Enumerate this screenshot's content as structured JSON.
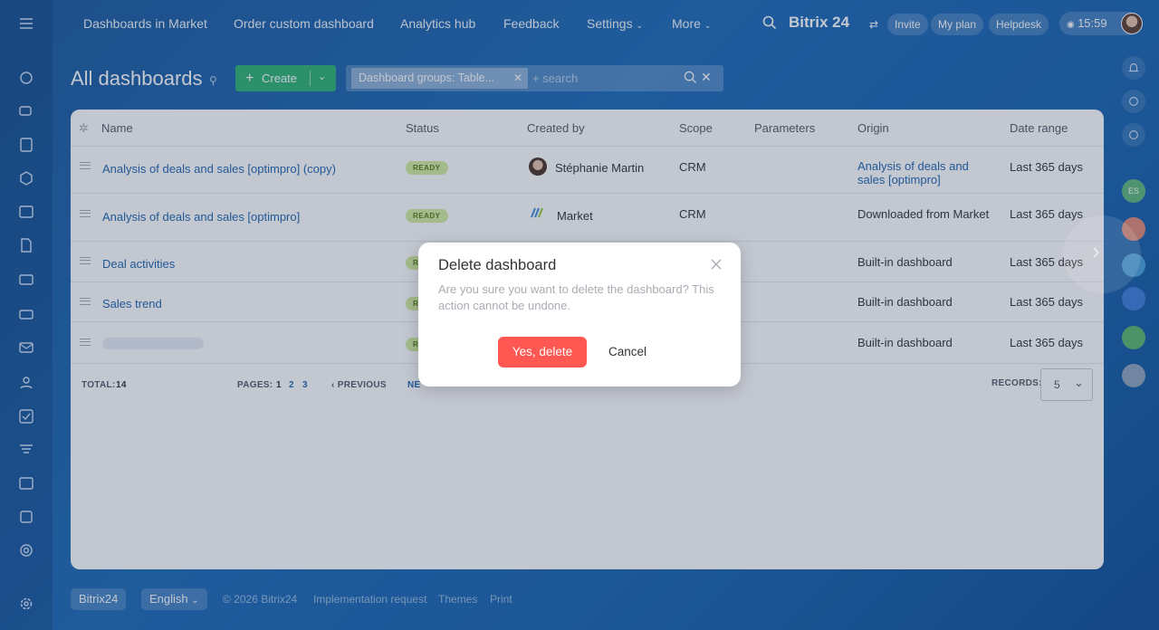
{
  "topnav": {
    "items": [
      "Dashboards in Market",
      "Order custom dashboard",
      "Analytics hub",
      "Feedback",
      "Settings",
      "More"
    ],
    "brand": "Bitrix 24",
    "invite": "Invite",
    "my_plan": "My plan",
    "helpdesk": "Helpdesk",
    "clock": "15:59"
  },
  "page": {
    "title": "All dashboards",
    "create_label": "Create",
    "filter_chip": "Dashboard groups: Table...",
    "search_placeholder": "+ search"
  },
  "grid": {
    "columns": [
      "Name",
      "Status",
      "Created by",
      "Scope",
      "Parameters",
      "Origin",
      "Date range"
    ],
    "rows": [
      {
        "name": "Analysis of deals and sales [optimpro] (copy)",
        "status": "READY",
        "created_by": "Stéphanie Martin",
        "scope": "CRM",
        "origin": "Analysis of deals and sales [optimpro]",
        "date_range": "Last 365 days"
      },
      {
        "name": "Analysis of deals and sales [optimpro]",
        "status": "READY",
        "created_by": "Market",
        "scope": "CRM",
        "origin": "Downloaded from Market",
        "date_range": "Last 365 days"
      },
      {
        "name": "Deal activities",
        "status": "R",
        "created_by": "",
        "scope": "",
        "origin": "Built-in dashboard",
        "date_range": "Last 365 days"
      },
      {
        "name": "Sales trend",
        "status": "R",
        "created_by": "",
        "scope": "",
        "origin": "Built-in dashboard",
        "date_range": "Last 365 days"
      },
      {
        "name": "",
        "status": "R",
        "created_by": "",
        "scope": "",
        "origin": "Built-in dashboard",
        "date_range": "Last 365 days"
      }
    ],
    "total_label": "TOTAL:",
    "total_value": "14",
    "pages_label": "PAGES:",
    "pages": [
      "1",
      "2",
      "3"
    ],
    "previous": "PREVIOUS",
    "next": "NE",
    "records_label": "RECORDS:",
    "records_value": "5"
  },
  "modal": {
    "title": "Delete dashboard",
    "text": "Are you sure you want to delete the dashboard? This action cannot be undone.",
    "confirm": "Yes, delete",
    "cancel": "Cancel"
  },
  "footer": {
    "brand": "Bitrix24",
    "language": "English",
    "copyright": "© 2026 Bitrix24",
    "implementation": "Implementation request",
    "themes": "Themes",
    "print": "Print"
  },
  "right_rail": {
    "avatar_initials": "ES"
  },
  "colors": {
    "accent_link": "#2067b0",
    "create_green": "#2fb574",
    "danger": "#ff5752",
    "ready_badge": "#d3ee9e"
  }
}
